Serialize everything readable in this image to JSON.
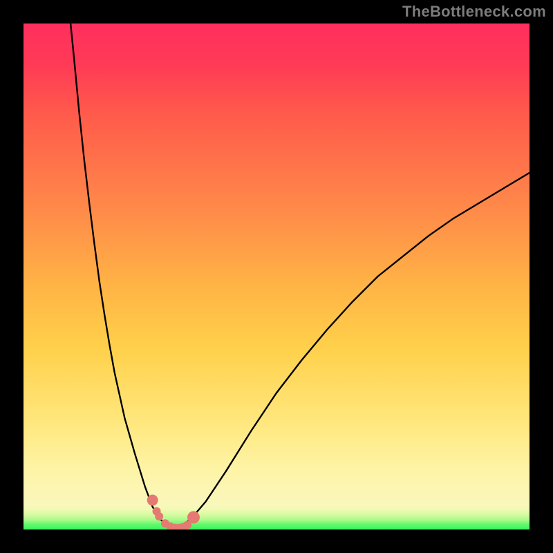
{
  "watermark": "TheBottleneck.com",
  "colors": {
    "watermark": "#7c7c7c",
    "curve": "#000000",
    "marker": "#e47a71",
    "background_frame": "#000000"
  },
  "chart_data": {
    "type": "line",
    "title": "",
    "xlabel": "",
    "ylabel": "",
    "xlim": [
      0,
      100
    ],
    "ylim": [
      0,
      100
    ],
    "note": "Axes are unlabeled in the source image; x/y values are normalized 0–100 estimates read from pixel positions. y=0 is the green (good) end, y=100 is the red (bottleneck) end.",
    "series": [
      {
        "name": "left-curve",
        "x": [
          9.3,
          10.0,
          11.0,
          12.0,
          13.0,
          14.0,
          15.0,
          16.0,
          17.0,
          18.0,
          20.0,
          22.0,
          24.0,
          25.5,
          27.0,
          30.0
        ],
        "y": [
          100.0,
          93.0,
          82.5,
          73.0,
          64.5,
          56.5,
          49.0,
          42.5,
          36.5,
          31.0,
          22.0,
          15.0,
          8.5,
          4.5,
          2.0,
          0.0
        ]
      },
      {
        "name": "right-curve",
        "x": [
          30.0,
          33.0,
          36.0,
          40.0,
          45.0,
          50.0,
          55.0,
          60.0,
          65.0,
          70.0,
          75.0,
          80.0,
          85.0,
          90.0,
          95.0,
          100.0
        ],
        "y": [
          0.0,
          2.0,
          5.5,
          11.5,
          19.5,
          27.0,
          33.5,
          39.5,
          45.0,
          50.0,
          54.0,
          58.0,
          61.5,
          64.5,
          67.5,
          70.5
        ]
      }
    ],
    "markers": {
      "name": "highlighted-points",
      "x": [
        25.5,
        26.3,
        26.8,
        28.0,
        29.0,
        30.0,
        30.8,
        31.6,
        32.4,
        33.6
      ],
      "y": [
        5.8,
        3.6,
        2.6,
        1.2,
        0.6,
        0.3,
        0.3,
        0.5,
        0.9,
        2.4
      ],
      "r": [
        8,
        6,
        6,
        6,
        6,
        6,
        6,
        6,
        6,
        9
      ]
    },
    "background_gradient": {
      "orientation": "vertical",
      "stops": [
        {
          "pos": 0.0,
          "color": "#38f55c"
        },
        {
          "pos": 0.03,
          "color": "#d8fba2"
        },
        {
          "pos": 0.12,
          "color": "#fef4a6"
        },
        {
          "pos": 0.36,
          "color": "#ffd04a"
        },
        {
          "pos": 0.62,
          "color": "#ff8d49"
        },
        {
          "pos": 0.82,
          "color": "#ff5b4b"
        },
        {
          "pos": 1.0,
          "color": "#ff2f5e"
        }
      ]
    }
  }
}
